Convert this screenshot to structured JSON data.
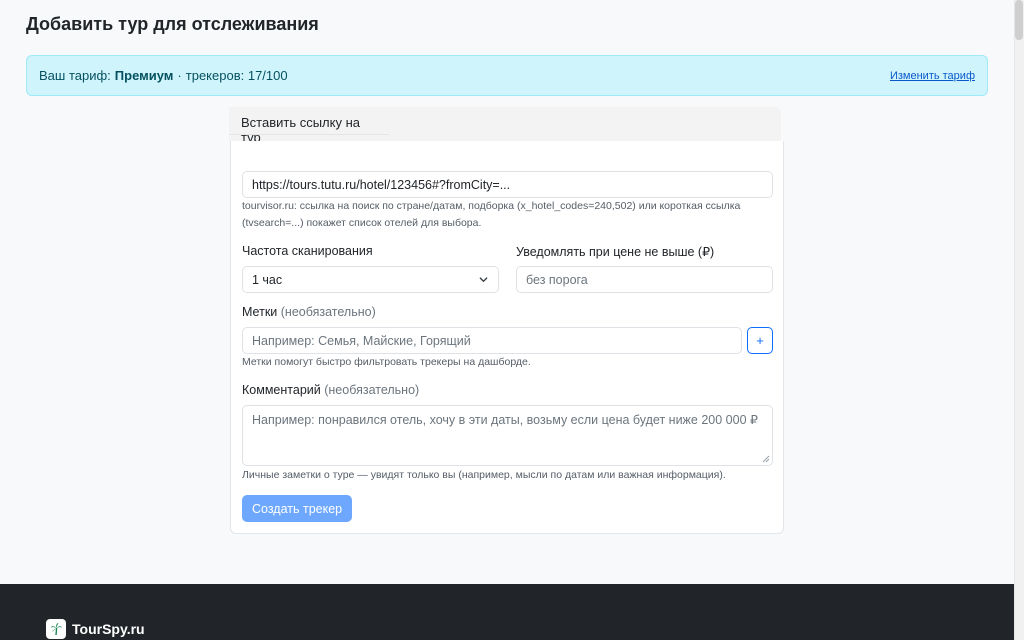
{
  "page": {
    "title": "Добавить тур для отслеживания"
  },
  "plan": {
    "label": "Ваш тариф:",
    "name": "Премиум",
    "separator": "·",
    "trackers_text": "трекеров: 17/100",
    "change_link": "Изменить тариф"
  },
  "tabs": {
    "active": "Вставить ссылку на тур"
  },
  "form": {
    "url": {
      "value": "https://tours.tutu.ru/hotel/123456#?fromCity=...",
      "hint": "tourvisor.ru: ссылка на поиск по стране/датам, подборка (x_hotel_codes=240,502) или короткая ссылка (tvsearch=...) покажет список отелей для выбора."
    },
    "frequency": {
      "label": "Частота сканирования",
      "value": "1 час"
    },
    "price_alert": {
      "label": "Уведомлять при цене не выше (₽)",
      "placeholder": "без порога"
    },
    "tags": {
      "label": "Метки",
      "optional": "(необязательно)",
      "placeholder": "Например: Семья, Майские, Горящий",
      "add_label": "+",
      "hint": "Метки помогут быстро фильтровать трекеры на дашборде."
    },
    "comment": {
      "label": "Комментарий",
      "optional": "(необязательно)",
      "placeholder": "Например: понравился отель, хочу в эти даты, возьму если цена будет ниже 200 000 ₽",
      "hint": "Личные заметки о туре — увидят только вы (например, мысли по датам или важная информация)."
    },
    "submit_label": "Создать трекер"
  },
  "footer": {
    "brand": "TourSpy.ru",
    "logo_icon": "palm-tree-icon"
  },
  "colors": {
    "banner_bg": "#cff4fc",
    "primary": "#0d6efd",
    "primary_disabled": "#6ea8fe",
    "footer_bg": "#212529"
  }
}
